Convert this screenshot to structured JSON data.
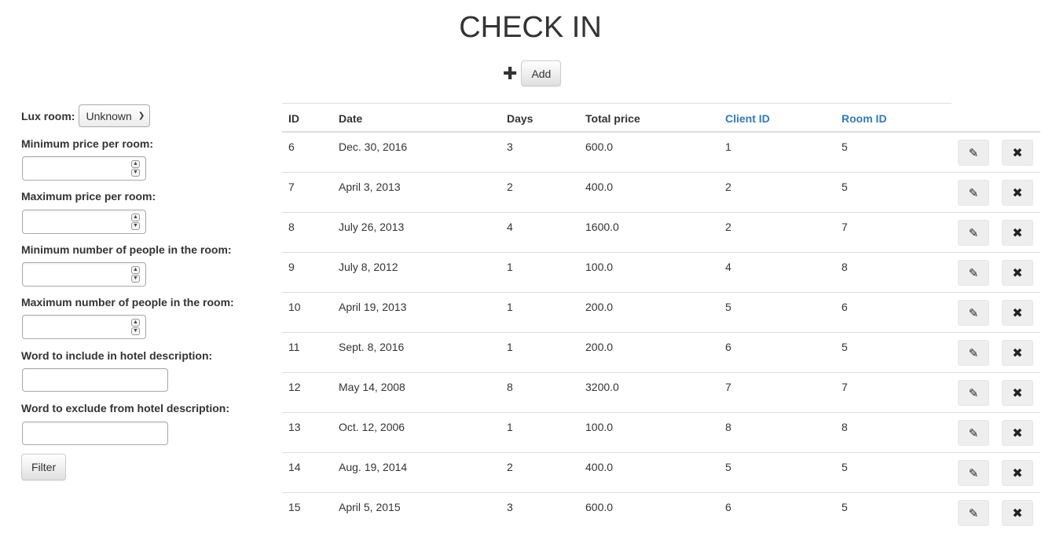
{
  "page": {
    "title": "CHECK IN",
    "add_label": "Add"
  },
  "filters": {
    "lux_label": "Lux room:",
    "lux_value": "Unknown",
    "min_price_label": "Minimum price per room:",
    "max_price_label": "Maximum price per room:",
    "min_people_label": "Minimum number of people in the room:",
    "max_people_label": "Maximum number of people in the room:",
    "include_label": "Word to include in hotel description:",
    "exclude_label": "Word to exclude from hotel description:",
    "filter_label": "Filter"
  },
  "icons": {
    "plus": "plus-icon",
    "select_caret": "chevron-down-icon",
    "spinner_up": "chevron-up-icon",
    "spinner_down": "chevron-down-icon",
    "edit": "pencil-icon",
    "delete": "remove-icon"
  },
  "table": {
    "columns": [
      "ID",
      "Date",
      "Days",
      "Total price",
      "Client ID",
      "Room ID"
    ],
    "link_color": "#337ab7",
    "rows": [
      [
        "6",
        "Dec. 30, 2016",
        "3",
        "600.0",
        "1",
        "5"
      ],
      [
        "7",
        "April 3, 2013",
        "2",
        "400.0",
        "2",
        "5"
      ],
      [
        "8",
        "July 26, 2013",
        "4",
        "1600.0",
        "2",
        "7"
      ],
      [
        "9",
        "July 8, 2012",
        "1",
        "100.0",
        "4",
        "8"
      ],
      [
        "10",
        "April 19, 2013",
        "1",
        "200.0",
        "5",
        "6"
      ],
      [
        "11",
        "Sept. 8, 2016",
        "1",
        "200.0",
        "6",
        "5"
      ],
      [
        "12",
        "May 14, 2008",
        "8",
        "3200.0",
        "7",
        "7"
      ],
      [
        "13",
        "Oct. 12, 2006",
        "1",
        "100.0",
        "8",
        "8"
      ],
      [
        "14",
        "Aug. 19, 2014",
        "2",
        "400.0",
        "5",
        "5"
      ],
      [
        "15",
        "April 5, 2015",
        "3",
        "600.0",
        "6",
        "5"
      ]
    ]
  }
}
